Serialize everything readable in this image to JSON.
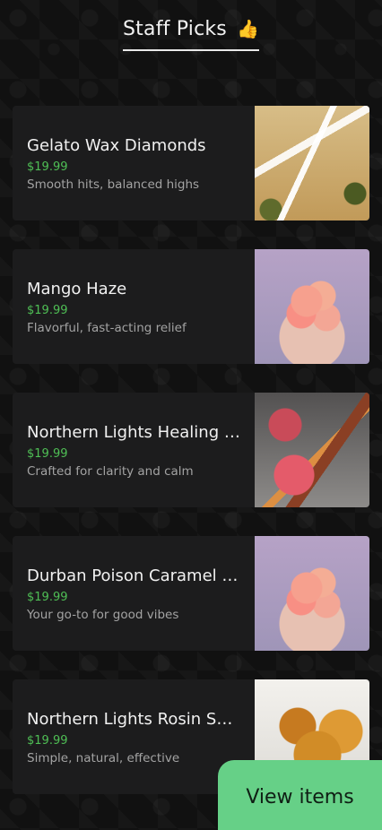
{
  "header": {
    "title": "Staff Picks",
    "emoji": "👍"
  },
  "products": [
    {
      "name": "Gelato Wax Diamonds",
      "price": "$19.99",
      "description": "Smooth hits, balanced highs",
      "image_icon": "joints-photo"
    },
    {
      "name": "Mango Haze",
      "price": "$19.99",
      "description": "Flavorful, fast-acting relief",
      "image_icon": "gummies-photo"
    },
    {
      "name": "Northern Lights Healing S...",
      "price": "$19.99",
      "description": "Crafted for clarity and calm",
      "image_icon": "grinder-photo"
    },
    {
      "name": "Durban Poison Caramel C...",
      "price": "$19.99",
      "description": "Your go-to for good vibes",
      "image_icon": "gummies-photo"
    },
    {
      "name": "Northern Lights Rosin Sau...",
      "price": "$19.99",
      "description": "Simple, natural, effective",
      "image_icon": "rosin-photo"
    }
  ],
  "cta": {
    "label": "View items"
  },
  "colors": {
    "background": "#111111",
    "card": "#1c1c1d",
    "price": "#4fbf55",
    "button": "#66d087"
  }
}
